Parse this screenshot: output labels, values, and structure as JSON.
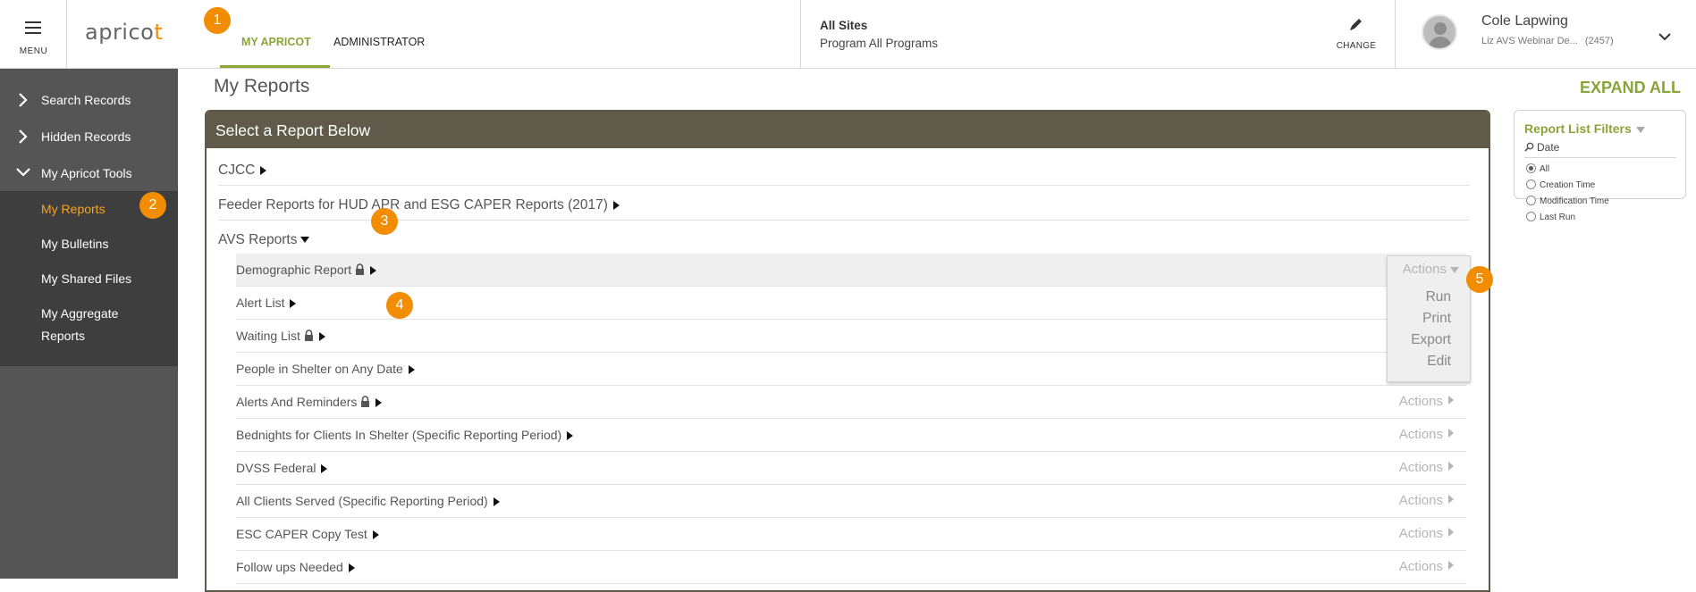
{
  "header": {
    "menu_label": "MENU",
    "logo": {
      "prefix": "aprico",
      "dot": "t"
    },
    "tabs": [
      {
        "label": "MY APRICOT",
        "active": true
      },
      {
        "label": "ADMINISTRATOR",
        "active": false
      }
    ],
    "site": {
      "title": "All Sites",
      "subtitle": "Program All Programs"
    },
    "change_label": "CHANGE",
    "user": {
      "name": "Cole Lapwing",
      "org": "Liz AVS Webinar De...",
      "id": "(2457)"
    }
  },
  "sidebar": {
    "items": [
      {
        "label": "Search Records",
        "expanded": false
      },
      {
        "label": "Hidden Records",
        "expanded": false
      },
      {
        "label": "My Apricot Tools",
        "expanded": true
      }
    ],
    "subitems": [
      {
        "label": "My Reports",
        "active": true
      },
      {
        "label": "My Bulletins",
        "active": false
      },
      {
        "label": "My Shared Files",
        "active": false
      },
      {
        "label": "My Aggregate Reports",
        "active": false
      }
    ]
  },
  "main": {
    "title": "My Reports",
    "expand_all": "EXPAND ALL",
    "panel_title": "Select a Report Below",
    "groups": [
      "CJCC",
      "Feeder Reports for HUD APR and ESG CAPER Reports (2017)",
      "AVS Reports"
    ],
    "reports": [
      {
        "name": "Demographic Report",
        "locked": true
      },
      {
        "name": "Alert List",
        "locked": false
      },
      {
        "name": "Waiting List",
        "locked": true
      },
      {
        "name": "People in Shelter on Any Date",
        "locked": false
      },
      {
        "name": "Alerts And Reminders",
        "locked": true
      },
      {
        "name": "Bednights for Clients In Shelter (Specific Reporting Period)",
        "locked": false
      },
      {
        "name": "DVSS Federal",
        "locked": false
      },
      {
        "name": "All Clients Served (Specific Reporting Period)",
        "locked": false
      },
      {
        "name": "ESC CAPER Copy Test",
        "locked": false
      },
      {
        "name": "Follow ups Needed",
        "locked": false
      }
    ],
    "actions_label": "Actions",
    "actions_menu": [
      "Run",
      "Print",
      "Export",
      "Edit"
    ]
  },
  "filters": {
    "title": "Report List Filters",
    "field": "Date",
    "options": [
      {
        "label": "All",
        "selected": true
      },
      {
        "label": "Creation Time",
        "selected": false
      },
      {
        "label": "Modification Time",
        "selected": false
      },
      {
        "label": "Last Run",
        "selected": false
      }
    ]
  },
  "badges": [
    "1",
    "2",
    "3",
    "4",
    "5"
  ],
  "colors": {
    "accent_green": "#8ba43a",
    "badge_orange": "#f28c00",
    "sidebar": "#555555",
    "panel_header": "#5f5a4a"
  }
}
